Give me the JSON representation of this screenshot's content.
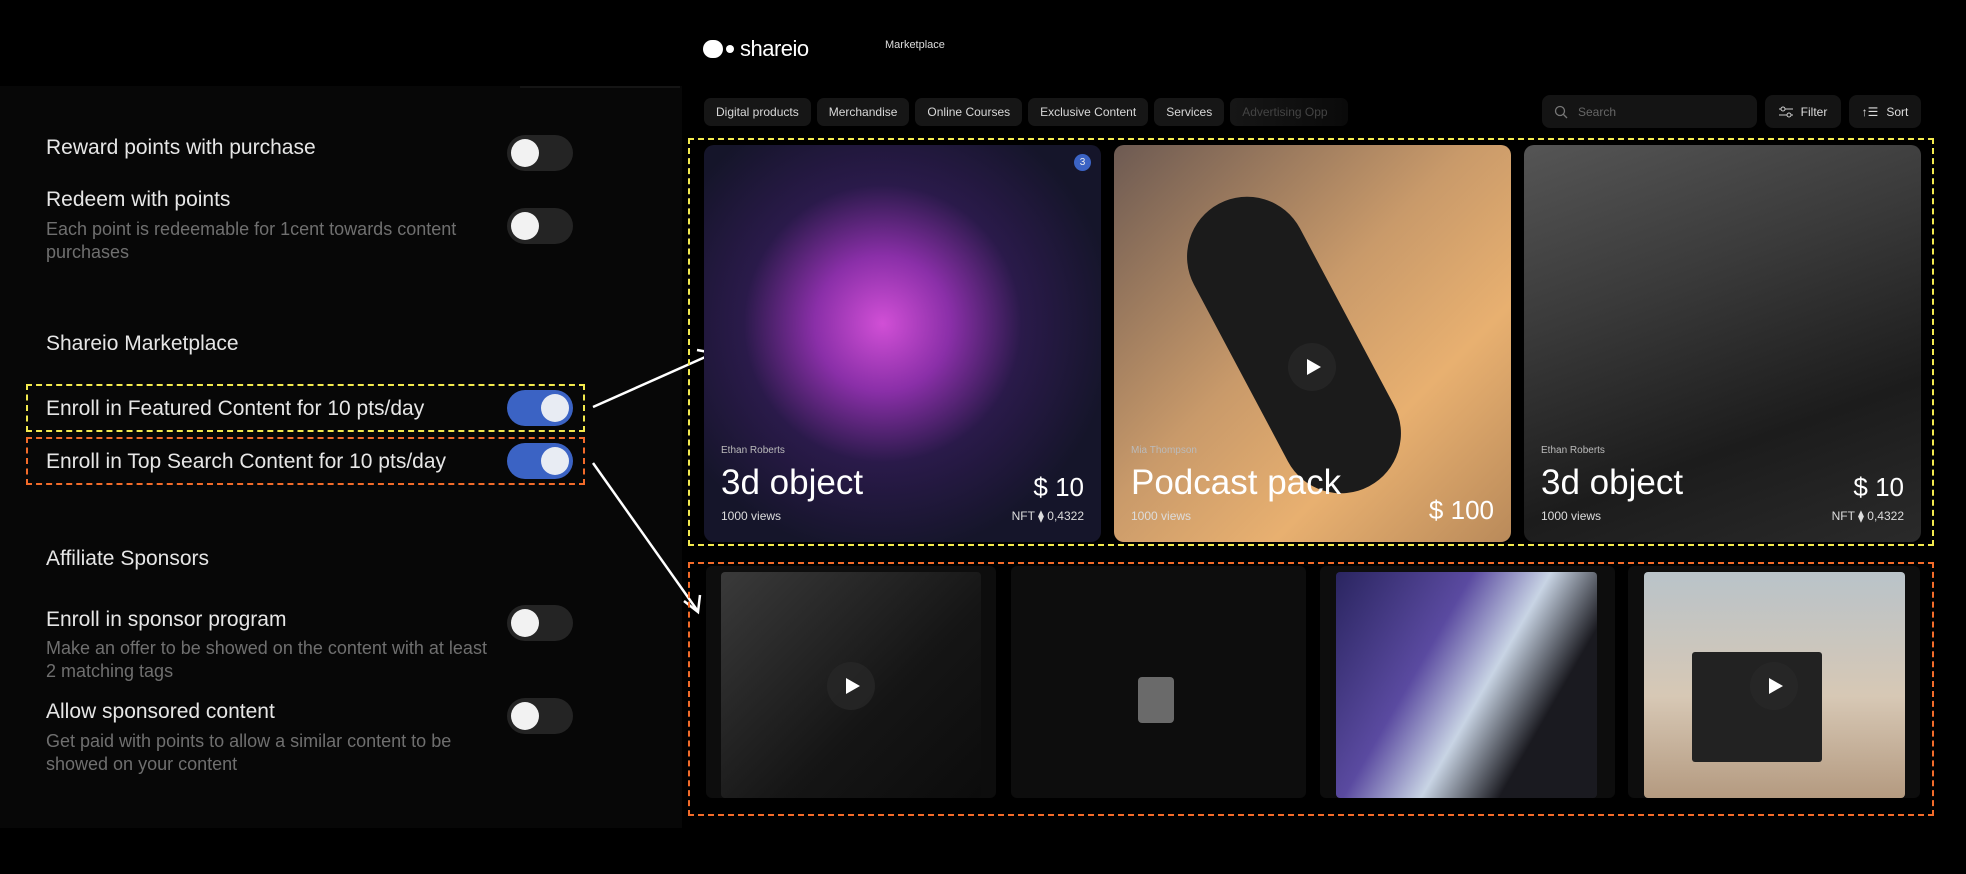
{
  "settings": {
    "reward": {
      "label": "Reward points with purchase",
      "on": false
    },
    "redeem": {
      "label": "Redeem with points",
      "desc": "Each point is redeemable for 1cent towards content purchases",
      "on": false
    },
    "marketplace_heading": "Shareio Marketplace",
    "featured": {
      "label": "Enroll in Featured Content for 10 pts/day",
      "on": true
    },
    "top_search": {
      "label": "Enroll in Top Search Content for 10 pts/day",
      "on": true
    },
    "affiliate_heading": "Affiliate Sponsors",
    "sponsor": {
      "label": "Enroll in sponsor program",
      "desc": "Make an offer to be showed on the content with at least 2 matching tags",
      "on": false
    },
    "sponsored": {
      "label": "Allow sponsored content",
      "desc": "Get paid with points to allow a similar content to be showed on your content",
      "on": false
    }
  },
  "header": {
    "logo": "shareio",
    "nav": "Marketplace"
  },
  "tabs": [
    "Digital products",
    "Merchandise",
    "Online Courses",
    "Exclusive Content",
    "Services",
    "Advertising Opp"
  ],
  "search": {
    "placeholder": "Search"
  },
  "filter_label": "Filter",
  "sort_label": "Sort",
  "featured_cards": [
    {
      "author": "Ethan Roberts",
      "title": "3d object",
      "price": "$ 10",
      "views": "1000 views",
      "nft": "NFT ⧫ 0,4322",
      "badge": "3"
    },
    {
      "author": "Mia Thompson",
      "title": "Podcast pack",
      "price": "$ 100",
      "views": "1000 views"
    },
    {
      "author": "Ethan Roberts",
      "title": "3d object",
      "price": "$ 10",
      "views": "1000 views",
      "nft": "NFT ⧫ 0,4322"
    }
  ],
  "colors": {
    "toggle_on": "#3b63c4",
    "featured_outline": "#f2e94e",
    "top_search_outline": "#f26b2a"
  }
}
